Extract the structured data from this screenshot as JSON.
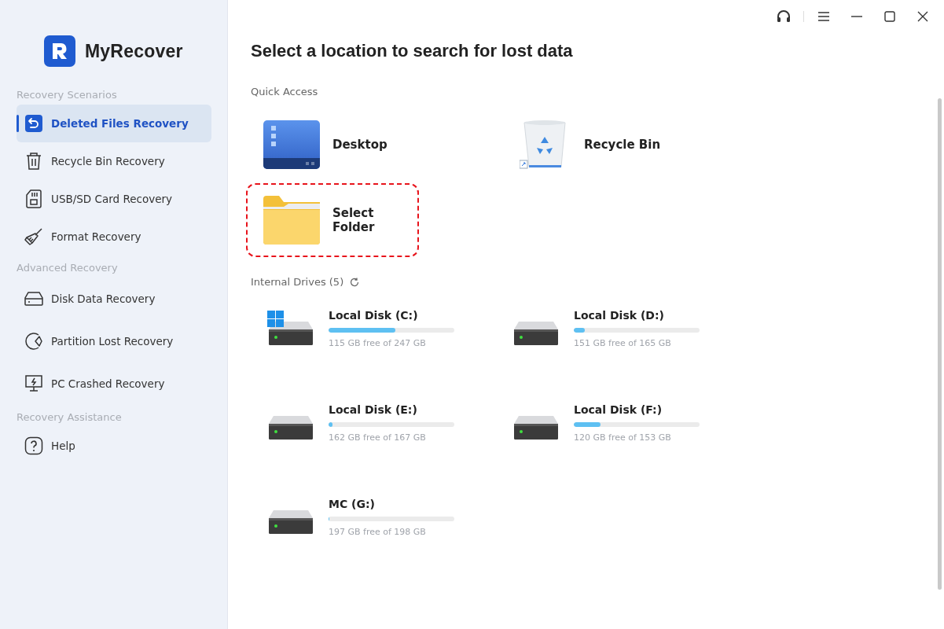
{
  "app": {
    "name": "MyRecover"
  },
  "sidebar": {
    "sections": [
      {
        "title": "Recovery Scenarios",
        "items": [
          {
            "label": "Deleted Files Recovery",
            "selected": true
          },
          {
            "label": "Recycle Bin Recovery",
            "selected": false
          },
          {
            "label": "USB/SD Card Recovery",
            "selected": false
          },
          {
            "label": "Format Recovery",
            "selected": false
          }
        ]
      },
      {
        "title": "Advanced Recovery",
        "items": [
          {
            "label": "Disk Data Recovery",
            "selected": false
          },
          {
            "label": "Partition Lost Recovery",
            "selected": false
          },
          {
            "label": "PC Crashed Recovery",
            "selected": false
          }
        ]
      },
      {
        "title": "Recovery Assistance",
        "items": [
          {
            "label": "Help",
            "selected": false
          }
        ]
      }
    ]
  },
  "main": {
    "title": "Select a location to search for lost data",
    "quick_access": {
      "title": "Quick Access",
      "items": [
        {
          "kind": "desktop",
          "label": "Desktop",
          "highlighted": false
        },
        {
          "kind": "recycle",
          "label": "Recycle Bin",
          "highlighted": false
        },
        {
          "kind": "folder",
          "label": "Select Folder",
          "highlighted": true
        }
      ]
    },
    "internal_drives": {
      "title": "Internal Drives (5)",
      "drives": [
        {
          "name": "Local Disk (C:)",
          "system": true,
          "level": 0.53,
          "caption": "115 GB free of 247 GB"
        },
        {
          "name": "Local Disk (D:)",
          "system": false,
          "level": 0.085,
          "caption": "151 GB free of 165 GB"
        },
        {
          "name": "Local Disk (E:)",
          "system": false,
          "level": 0.03,
          "caption": "162 GB free of 167 GB"
        },
        {
          "name": "Local Disk (F:)",
          "system": false,
          "level": 0.21,
          "caption": "120 GB free of 153 GB"
        },
        {
          "name": "MC (G:)",
          "system": false,
          "level": 0.005,
          "caption": "197 GB free of 198 GB"
        }
      ]
    }
  }
}
